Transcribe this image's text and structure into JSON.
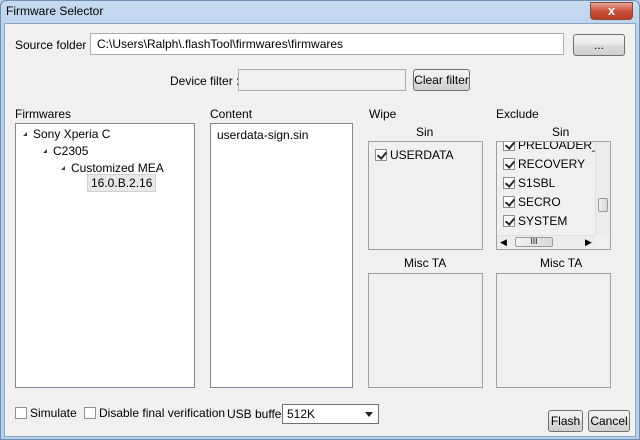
{
  "window": {
    "title": "Firmware Selector",
    "close_glyph": "x"
  },
  "source": {
    "label": "Source folder :",
    "value": "C:\\Users\\Ralph\\.flashTool\\firmwares\\firmwares",
    "browse_label": "..."
  },
  "filter": {
    "label": "Device filter :",
    "value": "",
    "clear_label": "Clear filter"
  },
  "firmwares": {
    "header": "Firmwares",
    "tree": {
      "device": "Sony Xperia C",
      "model": "C2305",
      "variant": "Customized MEA",
      "version": "16.0.B.2.16"
    }
  },
  "content": {
    "header": "Content",
    "items": [
      "userdata-sign.sin"
    ]
  },
  "wipe": {
    "header": "Wipe",
    "sin_label": "Sin",
    "sin_items": [
      {
        "label": "USERDATA",
        "checked": true
      }
    ],
    "misc_label": "Misc TA"
  },
  "exclude": {
    "header": "Exclude",
    "sin_label": "Sin",
    "sin_items": [
      {
        "label": "PRELOADER_ARIMA",
        "checked": true
      },
      {
        "label": "RECOVERY",
        "checked": true
      },
      {
        "label": "S1SBL",
        "checked": true
      },
      {
        "label": "SECRO",
        "checked": true
      },
      {
        "label": "SYSTEM",
        "checked": true
      }
    ],
    "misc_label": "Misc TA",
    "scroll_grip": "III"
  },
  "options": {
    "simulate_label": "Simulate",
    "simulate_checked": false,
    "disable_verification_label": "Disable final verification",
    "disable_verification_checked": false,
    "usb_buffer_label": "USB buffer",
    "usb_buffer_value": "512K"
  },
  "actions": {
    "flash_label": "Flash",
    "cancel_label": "Cancel"
  }
}
